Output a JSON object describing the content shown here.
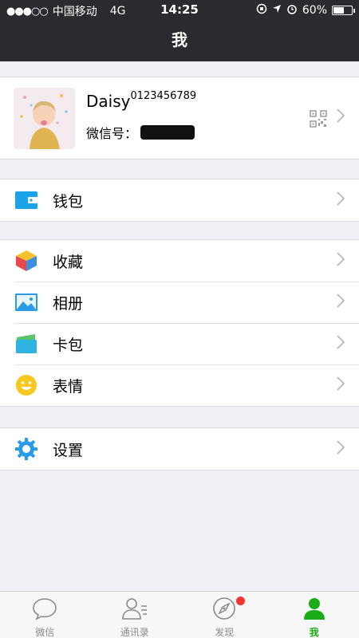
{
  "status_bar": {
    "signal": "●●●○○",
    "carrier": "中国移动",
    "network": "4G",
    "time": "14:25",
    "battery": "60%",
    "battery_level": 0.6
  },
  "header": {
    "title": "我"
  },
  "profile": {
    "name": "Daisy",
    "name_suffix": "0123456789",
    "wechat_id_label": "微信号："
  },
  "groups": {
    "wallet": [
      {
        "label": "钱包",
        "icon": "wallet-icon"
      }
    ],
    "collection": [
      {
        "label": "收藏",
        "icon": "favorites-icon"
      },
      {
        "label": "相册",
        "icon": "album-icon"
      },
      {
        "label": "卡包",
        "icon": "card-bag-icon"
      },
      {
        "label": "表情",
        "icon": "sticker-icon"
      }
    ],
    "settings": [
      {
        "label": "设置",
        "icon": "settings-icon"
      }
    ]
  },
  "tabbar": {
    "tabs": [
      {
        "label": "微信",
        "icon": "chat-icon"
      },
      {
        "label": "通讯录",
        "icon": "contacts-icon"
      },
      {
        "label": "发现",
        "icon": "compass-icon"
      },
      {
        "label": "我",
        "icon": "me-icon"
      }
    ],
    "active": "我"
  },
  "colors": {
    "header_bg": "#2b2b2f",
    "accent_green": "#1aad19",
    "badge_red": "#f43530",
    "page_bg": "#efeff4"
  }
}
